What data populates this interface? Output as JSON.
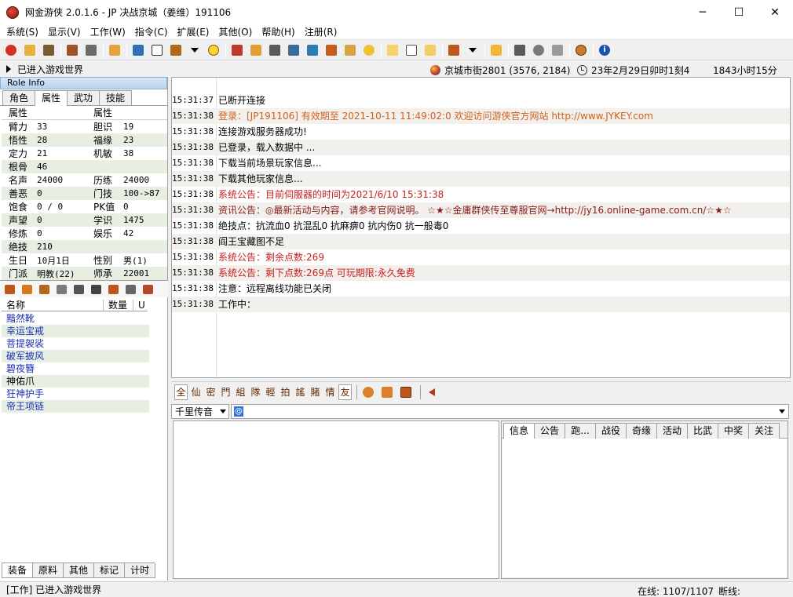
{
  "window": {
    "title": "网金游侠 2.0.1.6  - JP 决战京城（姜维）191106",
    "minimize": "─",
    "maximize": "☐",
    "close": "✕"
  },
  "menu": [
    "系统(S)",
    "显示(V)",
    "工作(W)",
    "指令(C)",
    "扩展(E)",
    "其他(O)",
    "帮助(H)",
    "注册(R)"
  ],
  "status_strip": {
    "left": "已进入游戏世界",
    "location": "京城市街2801 (3576, 2184)",
    "game_time": "23年2月29日卯时1刻4",
    "hours": "1843小时15分"
  },
  "left_panel": {
    "title": "Role Info",
    "tabs": [
      "角色",
      "属性",
      "武功",
      "技能"
    ],
    "table_headers": [
      "属性",
      "",
      "属性",
      ""
    ],
    "attributes": [
      [
        "臂力",
        "33",
        "胆识",
        "19"
      ],
      [
        "悟性",
        "28",
        "福缘",
        "23"
      ],
      [
        "定力",
        "21",
        "机敏",
        "38"
      ],
      [
        "根骨",
        "46",
        "",
        ""
      ],
      [
        "名声",
        "24000",
        "历练",
        "24000"
      ],
      [
        "善恶",
        "0",
        "门技",
        "100->87"
      ],
      [
        "饱食",
        "0 / 0",
        "PK值",
        "0"
      ],
      [
        "声望",
        "0",
        "学识",
        "1475"
      ],
      [
        "修炼",
        "0",
        "娱乐",
        "42"
      ],
      [
        "绝技",
        "210",
        "",
        ""
      ],
      [
        "生日",
        "10月1日",
        "性别",
        "男(1)"
      ],
      [
        "门派",
        "明教(22)",
        "师承",
        "22001"
      ]
    ],
    "item_headers": [
      "名称",
      "数量",
      "U"
    ],
    "items": [
      "黯然靴",
      "幸运宝戒",
      "菩提袈裟",
      "破军披风",
      "碧夜簪",
      "神佑爪",
      "狂神护手",
      "帝王项链"
    ],
    "bottom_tabs": [
      "装备",
      "原料",
      "其他",
      "标记",
      "计时"
    ]
  },
  "log": [
    {
      "time": "15:31:37",
      "msg": "已断开连接",
      "color": "black"
    },
    {
      "time": "15:31:38",
      "msg": "登录：[JP191106] 有效期至 2021-10-11 11:49:02:0 欢迎访问游侠官方网站 http://www.JYKEY.com",
      "color": "orange"
    },
    {
      "time": "15:31:38",
      "msg": "连接游戏服务器成功!",
      "color": "black"
    },
    {
      "time": "15:31:38",
      "msg": "已登录，载入数据中 ...",
      "color": "black"
    },
    {
      "time": "15:31:38",
      "msg": "下载当前场景玩家信息...",
      "color": "black"
    },
    {
      "time": "15:31:38",
      "msg": "下载其他玩家信息...",
      "color": "black"
    },
    {
      "time": "15:31:38",
      "msg": "系统公告：目前伺服器的时间为2021/6/10 15:31:38",
      "color": "red"
    },
    {
      "time": "15:31:38",
      "msg": "资讯公告：◎最新活动与内容，请参考官网说明。 ☆★☆金庸群侠传至尊服官网→http://jy16.online-game.com.cn/☆★☆",
      "color": "darkred"
    },
    {
      "time": "15:31:38",
      "msg": "绝技点：抗流血0 抗混乱0 抗麻痹0 抗内伤0 抗一般毒0",
      "color": "black"
    },
    {
      "time": "15:31:38",
      "msg": "阎王宝藏图不足",
      "color": "black"
    },
    {
      "time": "15:31:38",
      "msg": "系统公告：剩余点数:269",
      "color": "red"
    },
    {
      "time": "15:31:38",
      "msg": "系统公告：剩下点数:269点  可玩期限:永久免费",
      "color": "red"
    },
    {
      "time": "15:31:38",
      "msg": "注意：远程离线功能已关闭",
      "color": "black"
    },
    {
      "time": "15:31:38",
      "msg": "工作中：",
      "color": "black"
    }
  ],
  "channels": [
    "全",
    "仙",
    "密",
    "門",
    "組",
    "隊",
    "輕",
    "拍",
    "謠",
    "賭",
    "情",
    "友"
  ],
  "input": {
    "channel": "千里传音",
    "cursor": "@"
  },
  "right_tabs": [
    "信息",
    "公告",
    "跑...",
    "战役",
    "奇缘",
    "活动",
    "比武",
    "中奖",
    "关注"
  ],
  "statusbar": {
    "left": "[工作] 已进入游戏世界",
    "online": "在线: 1107/1107",
    "disconnect": "断线:"
  }
}
